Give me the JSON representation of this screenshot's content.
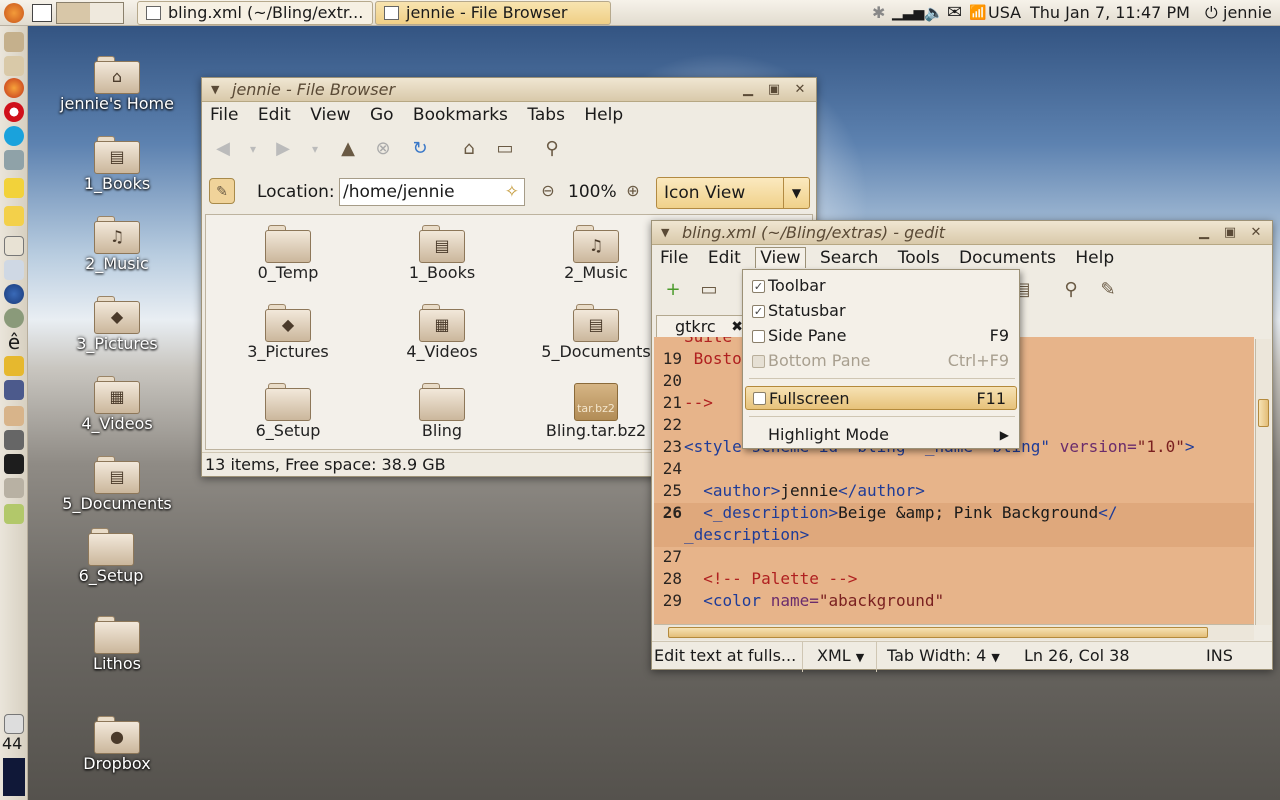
{
  "top_panel": {
    "tasks": [
      {
        "label": "bling.xml (~/Bling/extr..."
      },
      {
        "label": "jennie - File Browser"
      }
    ],
    "keyboard": "USA",
    "clock": "Thu Jan  7, 11:47 PM",
    "user": "jennie"
  },
  "left_panel": {
    "counter": "44"
  },
  "desktop_icons": [
    {
      "label": "jennie's Home",
      "emblem": "home-icon"
    },
    {
      "label": "1_Books",
      "emblem": "document-icon"
    },
    {
      "label": "2_Music",
      "emblem": "music-icon"
    },
    {
      "label": "3_Pictures",
      "emblem": "picture-icon"
    },
    {
      "label": "4_Videos",
      "emblem": "film-icon"
    },
    {
      "label": "5_Documents",
      "emblem": "document-icon"
    },
    {
      "label": "6_Setup",
      "emblem": ""
    },
    {
      "label": "Lithos",
      "emblem": ""
    },
    {
      "label": "Dropbox",
      "emblem": "person-icon"
    }
  ],
  "file_browser": {
    "title": "jennie - File Browser",
    "menu": [
      "File",
      "Edit",
      "View",
      "Go",
      "Bookmarks",
      "Tabs",
      "Help"
    ],
    "location_label": "Location:",
    "location_value": "/home/jennie",
    "zoom": "100%",
    "view_mode": "Icon View",
    "items": [
      "0_Temp",
      "1_Books",
      "2_Music",
      "3_Pictures",
      "4_Videos",
      "5_Documents",
      "6_Setup",
      "Bling",
      "Bling.tar.bz2"
    ],
    "archive_badge": "tar.bz2",
    "status": "13 items, Free space: 38.9 GB"
  },
  "gedit": {
    "title": "bling.xml (~/Bling/extras) - gedit",
    "menu": [
      "File",
      "Edit",
      "View",
      "Search",
      "Tools",
      "Documents",
      "Help"
    ],
    "tab_label": "gtkrc",
    "lines": {
      "n19": "19",
      "t19": " Bosto",
      "n20": "20",
      "n21": "21",
      "t21": "-->",
      "n22": "22",
      "n23": "23",
      "t23a": "<style-scheme id=\"bling\" _name=\"bling\" ",
      "t23b": "version=",
      "t23c": "\"1.0\"",
      "t23d": ">",
      "n24": "24",
      "n25": "25",
      "t25a": "  <author>",
      "t25b": "jennie",
      "t25c": "</author>",
      "n26": "26",
      "t26a": "  <_description>",
      "t26b": "Beige &amp; Pink Background",
      "t26c": "</",
      "t26d": "_description>",
      "n27": "27",
      "n28": "28",
      "t28": "  <!-- Palette -->",
      "n29": "29",
      "t29a": "  <color ",
      "t29b": "name=",
      "t29c": "\"abackground\""
    },
    "status": {
      "hint": "Edit text at fulls...",
      "language": "XML",
      "tab_width": "Tab Width:  4",
      "position": "Ln 26, Col 38",
      "mode": "INS"
    }
  },
  "view_menu": {
    "items": [
      {
        "label": "Toolbar",
        "checked": true,
        "accel": ""
      },
      {
        "label": "Statusbar",
        "checked": true,
        "accel": ""
      },
      {
        "label": "Side Pane",
        "checked": false,
        "accel": "F9"
      },
      {
        "label": "Bottom Pane",
        "checked": false,
        "accel": "Ctrl+F9"
      },
      {
        "label": "Fullscreen",
        "checked": false,
        "accel": "F11"
      },
      {
        "label": "Highlight Mode",
        "accel": ""
      }
    ]
  }
}
